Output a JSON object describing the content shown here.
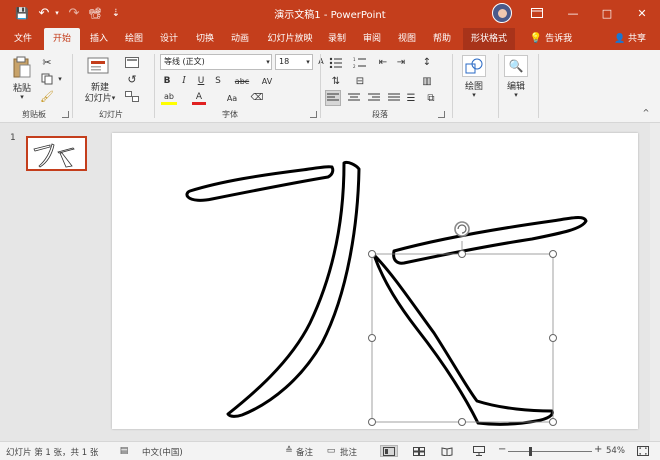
{
  "window": {
    "title": "演示文稿1 - PowerPoint",
    "accent": "#c43e1c",
    "minimize": "—",
    "maximize": "□",
    "close": "✕"
  },
  "quick_access": {
    "save": "💾",
    "undo": "↶",
    "redo": "↷",
    "present": "📽",
    "customize": "⇣"
  },
  "tabs": [
    "文件",
    "开始",
    "插入",
    "绘图",
    "设计",
    "切换",
    "动画",
    "幻灯片放映",
    "录制",
    "审阅",
    "视图",
    "帮助",
    "形状格式"
  ],
  "active_tab": "开始",
  "tell_me": "告诉我",
  "share": "共享",
  "ribbon": {
    "clipboard": {
      "paste": "粘贴",
      "label": "剪贴板"
    },
    "slides": {
      "new_slide": "新建",
      "new_slide_2": "幻灯片",
      "label": "幻灯片"
    },
    "font": {
      "font_name": "等线 (正文)",
      "font_size": "18",
      "grow": "A^",
      "shrink": "Aˇ",
      "clear": "A",
      "bold": "B",
      "italic": "I",
      "underline": "U",
      "shadow": "S",
      "strike": "abc",
      "spacing": "AV",
      "case": "Aa",
      "highlight": "ab",
      "font_color": "A",
      "label": "字体"
    },
    "paragraph": {
      "label": "段落"
    },
    "drawing": {
      "label": "绘图"
    },
    "editing": {
      "label": "编辑"
    }
  },
  "thumbnails": [
    {
      "number": "1"
    }
  ],
  "status": {
    "slide_info": "幻灯片 第 1 张，共 1 张",
    "language": "中文(中国)",
    "notes": "备注",
    "comments": "批注",
    "zoom": "54%"
  }
}
